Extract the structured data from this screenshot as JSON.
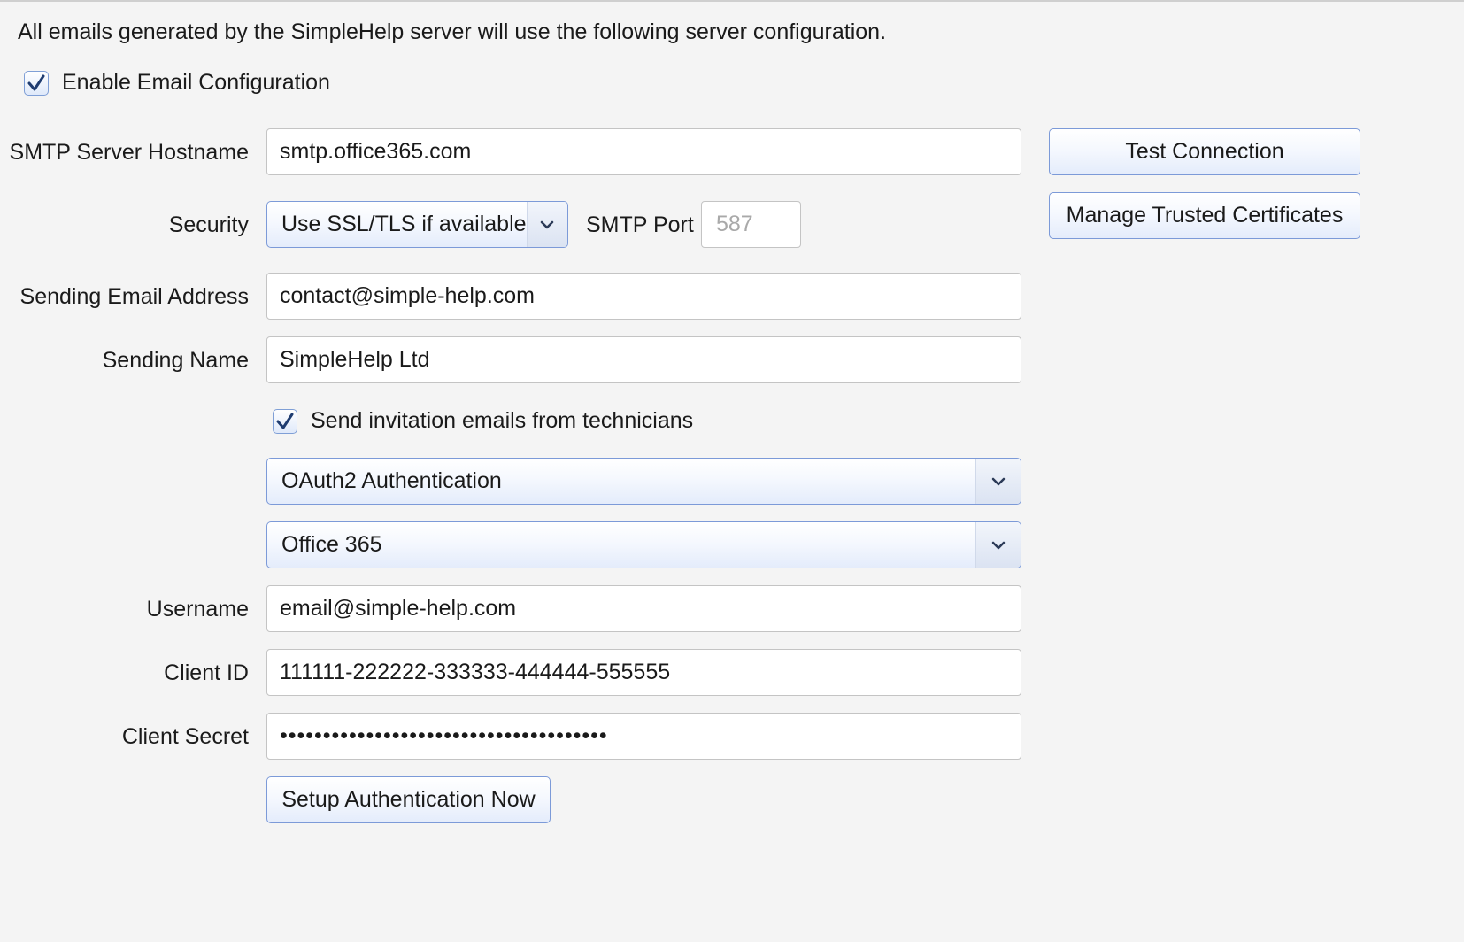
{
  "intro_text": "All emails generated by the SimpleHelp server will use the following server configuration.",
  "enable_email": {
    "label": "Enable Email Configuration",
    "checked": true
  },
  "smtp_hostname": {
    "label": "SMTP Server Hostname",
    "value": "smtp.office365.com"
  },
  "security": {
    "label": "Security",
    "selected": "Use SSL/TLS if available"
  },
  "smtp_port": {
    "label": "SMTP Port",
    "placeholder": "587"
  },
  "sending_email": {
    "label": "Sending Email Address",
    "value": "contact@simple-help.com"
  },
  "sending_name": {
    "label": "Sending Name",
    "value": "SimpleHelp Ltd"
  },
  "invite_from_techs": {
    "label": "Send invitation emails from technicians",
    "checked": true
  },
  "auth_method": {
    "selected": "OAuth2 Authentication"
  },
  "auth_provider": {
    "selected": "Office 365"
  },
  "username": {
    "label": "Username",
    "value": "email@simple-help.com"
  },
  "client_id": {
    "label": "Client ID",
    "value": "111111-222222-333333-444444-555555"
  },
  "client_secret": {
    "label": "Client Secret",
    "value": "••••••••••••••••••••••••••••••••••••••"
  },
  "buttons": {
    "setup_auth": "Setup Authentication Now",
    "test_connection": "Test Connection",
    "manage_certs": "Manage Trusted Certificates"
  },
  "icons": {
    "checkmark": "checkmark-icon",
    "dropdown": "chevron-down-icon"
  },
  "colors": {
    "accent_border": "#7c9ad8",
    "background": "#f4f4f4"
  }
}
